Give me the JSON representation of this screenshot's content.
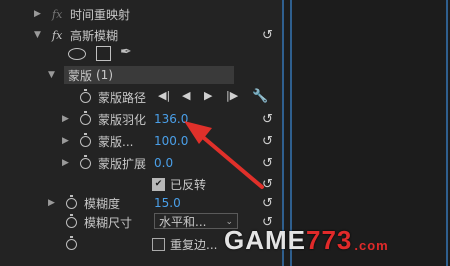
{
  "effects": {
    "time_remap": {
      "label": "时间重映射"
    },
    "gaussian_blur": {
      "label": "高斯模糊"
    }
  },
  "mask": {
    "label": "蒙版",
    "index_label": "(1)",
    "path_label": "蒙版路径",
    "feather_label": "蒙版羽化",
    "feather_value": "136.0",
    "opacity_label": "蒙版...",
    "opacity_value": "100.0",
    "expansion_label": "蒙版扩展",
    "expansion_value": "0.0",
    "inverted_label": "已反转",
    "inverted_checked": true
  },
  "blur": {
    "blurriness_label": "模糊度",
    "blurriness_value": "15.0",
    "dimensions_label": "模糊尺寸",
    "dimensions_value": "水平和...",
    "repeat_edge_label": "重复边...",
    "repeat_edge_checked": false
  },
  "icons": {
    "fx": "fx",
    "reset": "reset-icon",
    "stopwatch": "stopwatch-icon",
    "wrench": "wrench-icon"
  },
  "watermark": {
    "brand": "GAME",
    "number": "773",
    "suffix": ".com"
  },
  "colors": {
    "value_blue": "#4a9fe8",
    "arrow_red": "#e0302a",
    "divider_blue": "#2f5f8e"
  }
}
